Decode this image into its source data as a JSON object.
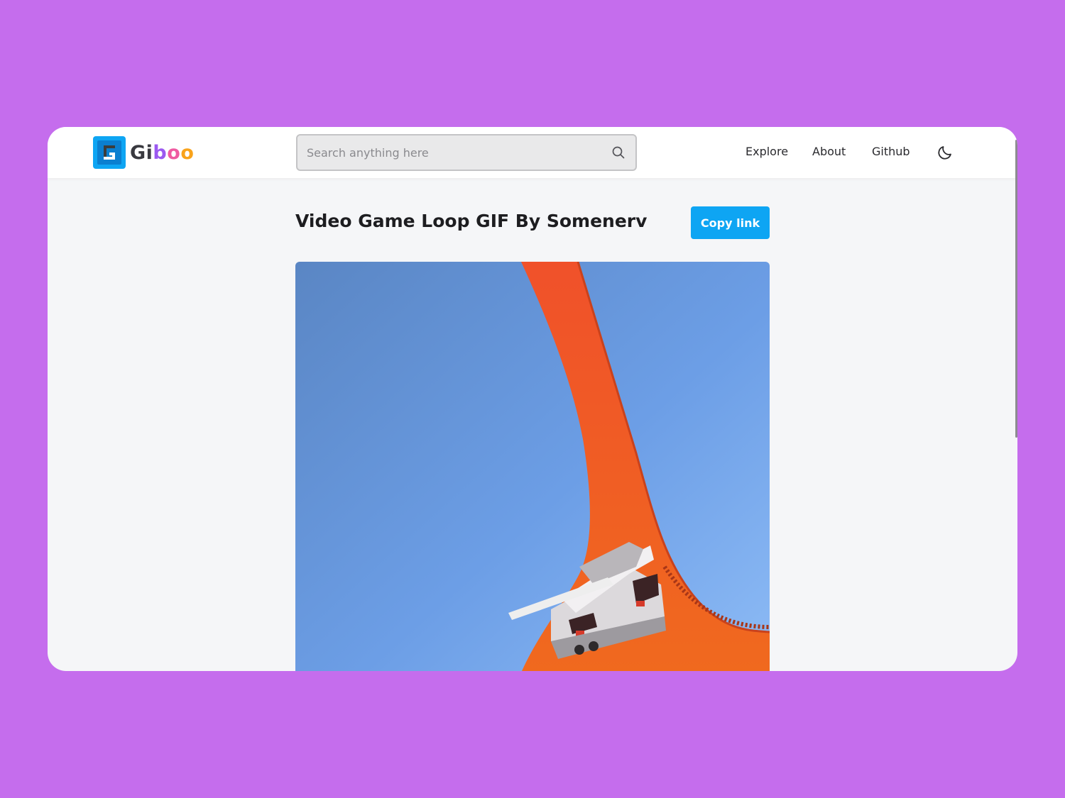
{
  "brand": {
    "name_parts": [
      "Gi",
      "b",
      "o",
      "o"
    ],
    "colors": {
      "mark_bg": "#0ea5f3",
      "gi": "#39393f",
      "b": "#9b59f0",
      "o1": "#ef5aa1",
      "o2": "#f9a31b"
    }
  },
  "search": {
    "placeholder": "Search anything here",
    "value": "",
    "icon": "search-icon"
  },
  "nav": {
    "links": [
      {
        "label": "Explore"
      },
      {
        "label": "About"
      },
      {
        "label": "Github"
      }
    ],
    "theme_toggle_icon": "moon-icon"
  },
  "main": {
    "title": "Video Game Loop GIF By Somenerv",
    "copy_button_label": "Copy link",
    "accent_color": "#0ea5f3"
  },
  "page_background": "#c56ded"
}
